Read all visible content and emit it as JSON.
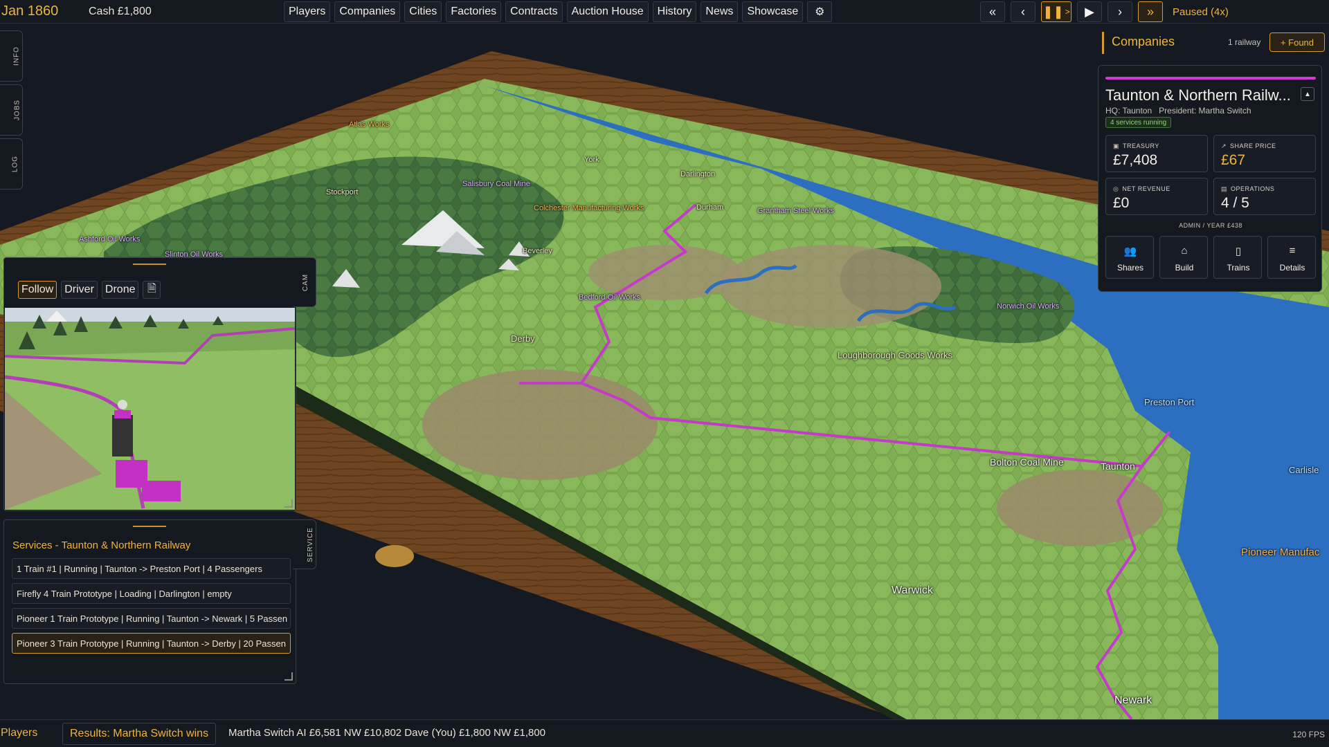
{
  "topbar": {
    "date": "Jan 1860",
    "cash": "Cash £1,800",
    "nav": [
      "Players",
      "Companies",
      "Cities",
      "Factories",
      "Contracts",
      "Auction House",
      "History",
      "News",
      "Showcase"
    ],
    "settings_icon": "gear-icon",
    "speed_controls": [
      "rewind-fast-icon",
      "step-back-icon",
      "pause-icon",
      "play-icon",
      "step-forward-icon",
      "fast-forward-icon"
    ],
    "pause_label": "> ",
    "status": "Paused (4x)"
  },
  "side_tabs": [
    "INFO",
    "JOBS",
    "LOG"
  ],
  "camera": {
    "tab": "CAM",
    "modes": [
      "Follow",
      "Driver",
      "Drone"
    ],
    "active_mode": "Follow",
    "doc_icon": "document-icon"
  },
  "services": {
    "tab": "SERVICE",
    "title": "Services - Taunton & Northern Railway",
    "rows": [
      "1 Train #1 | Running | Taunton -> Preston Port | 4 Passengers",
      "Firefly 4 Train Prototype | Loading | Darlington | empty",
      "Pioneer 1 Train Prototype | Running | Taunton -> Newark | 5 Passen",
      "Pioneer 3 Train Prototype | Running | Taunton -> Derby | 20 Passen"
    ],
    "selected_index": 3
  },
  "companies": {
    "title": "Companies",
    "count": "1 railway",
    "found_button": "+ Found",
    "card": {
      "name": "Taunton & Northern Railw...",
      "hq": "HQ: Taunton",
      "president": "President: Martha Switch",
      "badge": "4 services running",
      "accent_color": "#d13ad6",
      "stats": [
        {
          "label": "TREASURY",
          "value": "£7,408",
          "icon": "treasury-icon"
        },
        {
          "label": "SHARE PRICE",
          "value": "£67",
          "icon": "trend-up-icon"
        },
        {
          "label": "NET REVENUE",
          "value": "£0",
          "icon": "revenue-icon"
        },
        {
          "label": "OPERATIONS",
          "value": "4 / 5",
          "icon": "operations-icon"
        }
      ],
      "admin": "ADMIN / YEAR   £438",
      "actions": [
        {
          "label": "Shares",
          "icon": "users-icon"
        },
        {
          "label": "Build",
          "icon": "build-icon"
        },
        {
          "label": "Trains",
          "icon": "train-icon"
        },
        {
          "label": "Details",
          "icon": "details-icon"
        }
      ]
    }
  },
  "map_labels": [
    {
      "text": "Atlas Works",
      "kind": "factory orange"
    },
    {
      "text": "Stockport",
      "kind": "city"
    },
    {
      "text": "Salisbury Coal Mine",
      "kind": "factory"
    },
    {
      "text": "York",
      "kind": "city"
    },
    {
      "text": "Darlington",
      "kind": "city"
    },
    {
      "text": "Colchester Manufacturing Works",
      "kind": "factory orange"
    },
    {
      "text": "Durham",
      "kind": "city"
    },
    {
      "text": "Grantham Steel Works",
      "kind": "factory"
    },
    {
      "text": "Ashford Oil Works",
      "kind": "factory"
    },
    {
      "text": "Slinton Oil Works",
      "kind": "factory"
    },
    {
      "text": "Beverley",
      "kind": "city"
    },
    {
      "text": "Bedford Oil Works",
      "kind": "factory"
    },
    {
      "text": "Norwich Oil Works",
      "kind": "factory"
    },
    {
      "text": "Derby",
      "kind": "city"
    },
    {
      "text": "Loughborough Goods Works",
      "kind": "city"
    },
    {
      "text": "Preston Port",
      "kind": "port"
    },
    {
      "text": "Bolton Coal Mine",
      "kind": "city-mid"
    },
    {
      "text": "Taunton",
      "kind": "city-mid"
    },
    {
      "text": "Carlisle",
      "kind": "port"
    },
    {
      "text": "Pioneer Manufac",
      "kind": "factory orange"
    },
    {
      "text": "Warwick",
      "kind": "city-mid"
    },
    {
      "text": "Newark",
      "kind": "city-big"
    }
  ],
  "bottombar": {
    "players": "Players",
    "results": "Results: Martha Switch wins",
    "standings": "Martha Switch AI  £6,581  NW £10,802   Dave (You)  £1,800  NW £1,800",
    "fps": "120 FPS"
  }
}
